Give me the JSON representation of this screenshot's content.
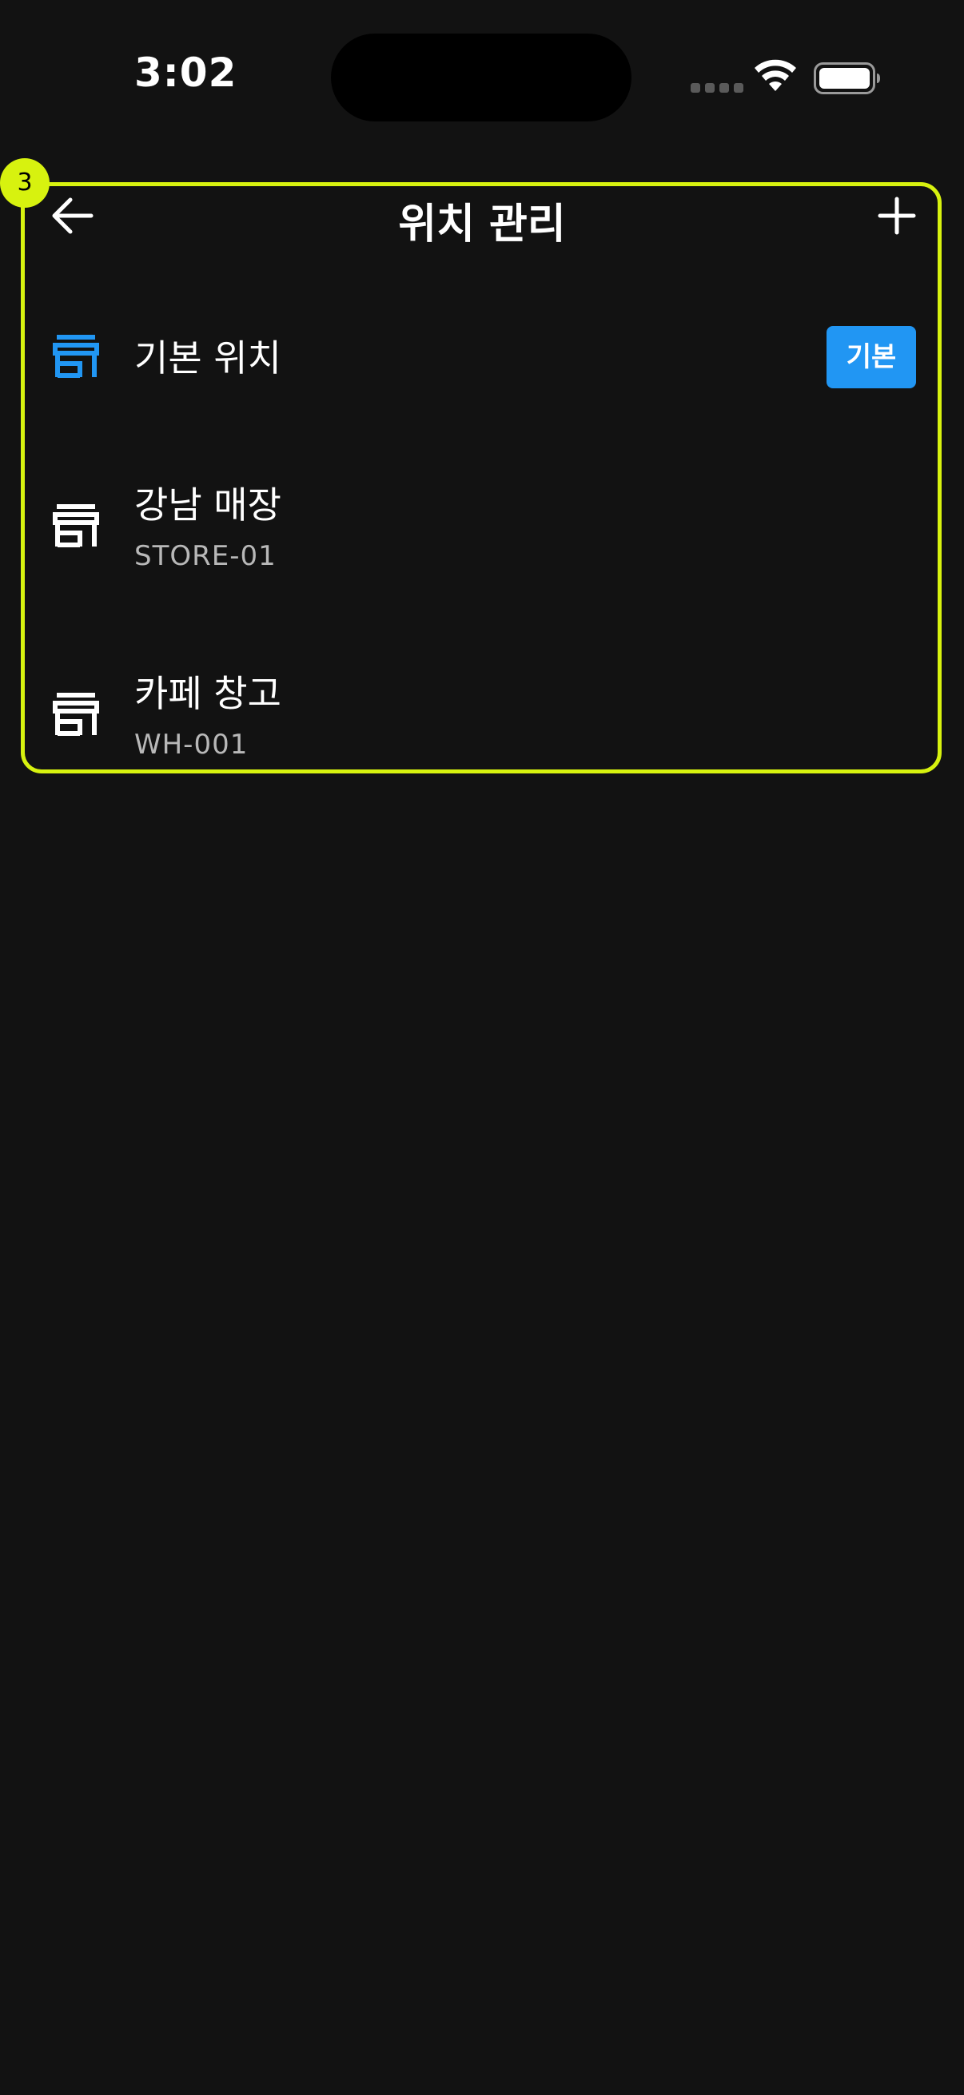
{
  "status_bar": {
    "time": "3:02",
    "wifi_icon": "wifi-icon",
    "battery_icon": "battery-full-icon"
  },
  "highlight": {
    "marker": "3",
    "color": "#d7f20f"
  },
  "app_bar": {
    "title": "위치 관리",
    "back_icon": "arrow-back-icon",
    "add_icon": "plus-icon"
  },
  "locations": [
    {
      "name": "기본 위치",
      "code": "",
      "icon": "store-icon",
      "icon_color": "#2196f3",
      "badge": "기본"
    },
    {
      "name": "강남 매장",
      "code": "STORE-01",
      "icon": "store-icon",
      "icon_color": "#ffffff",
      "badge": ""
    },
    {
      "name": "카페 창고",
      "code": "WH-001",
      "icon": "store-icon",
      "icon_color": "#ffffff",
      "badge": ""
    }
  ],
  "colors": {
    "background": "#121212",
    "accent": "#2196f3",
    "highlight": "#d7f20f",
    "secondary_text": "#b8b8b8"
  }
}
